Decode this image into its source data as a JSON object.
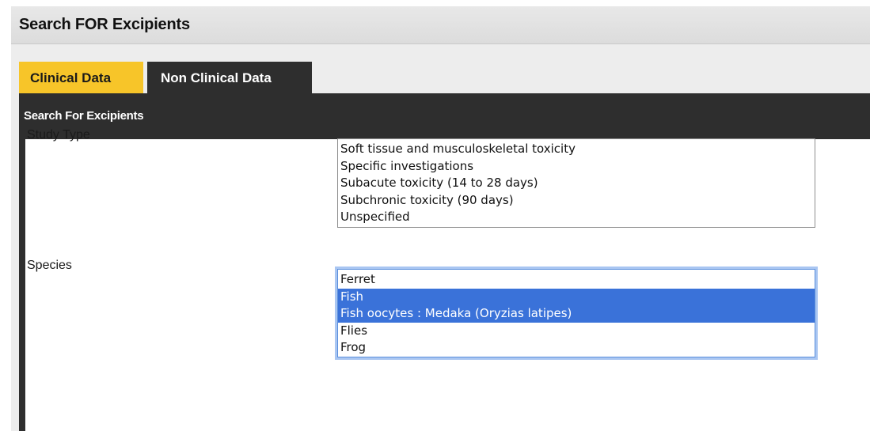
{
  "page": {
    "title": "Search FOR Excipients"
  },
  "tabs": [
    {
      "label": "Clinical Data",
      "active": true
    },
    {
      "label": "Non Clinical Data",
      "active": false
    }
  ],
  "section": {
    "header": "Search For Excipients"
  },
  "form": {
    "study_type": {
      "label": "Study Type",
      "options": [
        "Soft tissue and musculoskeletal toxicity",
        "Specific investigations",
        "Subacute toxicity (14 to 28 days)",
        "Subchronic toxicity (90 days)",
        "Unspecified"
      ],
      "selected": []
    },
    "species": {
      "label": "Species",
      "options": [
        "Ferret",
        "Fish",
        "Fish oocytes : Medaka (Oryzias latipes)",
        "Flies",
        "Frog"
      ],
      "selected": [
        "Fish",
        "Fish oocytes : Medaka (Oryzias latipes)"
      ],
      "focused": true
    }
  },
  "colors": {
    "tab_active": "#f7c529",
    "tab_inactive": "#2e2e2e",
    "header_bg": "#2e2e2e",
    "selection": "#3a72d9",
    "focus_ring": "#a9c6f2"
  }
}
